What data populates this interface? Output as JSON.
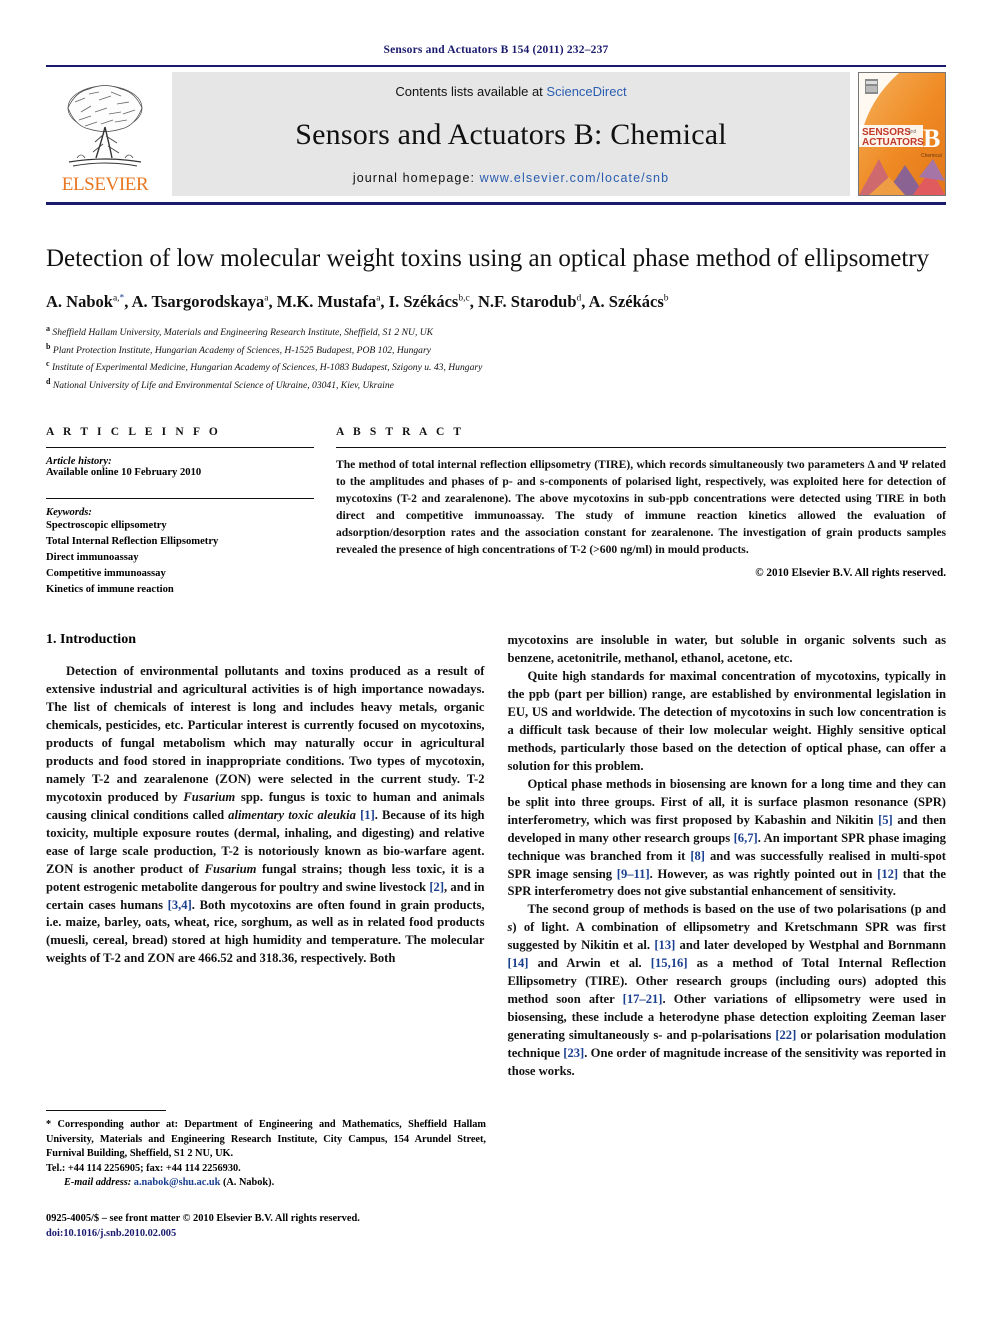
{
  "running_head": "Sensors and Actuators B 154 (2011) 232–237",
  "masthead": {
    "contents_prefix": "Contents lists available at ",
    "sciencedirect": "ScienceDirect",
    "journal_name": "Sensors and Actuators B: Chemical",
    "homepage_label": "journal homepage:",
    "homepage_url": "www.elsevier.com/locate/snb",
    "publisher": "ELSEVIER",
    "cover_line1": "SENSORS",
    "cover_line2": "ACTUATORS",
    "cover_and": "and",
    "cover_letter": "B",
    "cover_sub": "Chemical",
    "accent_blue": "#1a1a6e",
    "accent_orange": "#e87722",
    "link_blue": "#2a5db0"
  },
  "article": {
    "title": "Detection of low molecular weight toxins using an optical phase method of ellipsometry",
    "authors": [
      {
        "name": "A. Nabok",
        "sup": "a,",
        "star": "*"
      },
      {
        "name": "A. Tsargorodskaya",
        "sup": "a"
      },
      {
        "name": "M.K. Mustafa",
        "sup": "a"
      },
      {
        "name": "I. Székács",
        "sup": "b,c"
      },
      {
        "name": "N.F. Starodub",
        "sup": "d"
      },
      {
        "name": "A. Székács",
        "sup": "b"
      }
    ],
    "affiliations": [
      {
        "mark": "a",
        "text": "Sheffield Hallam University, Materials and Engineering Research Institute, Sheffield, S1 2 NU, UK"
      },
      {
        "mark": "b",
        "text": "Plant Protection Institute, Hungarian Academy of Sciences, H-1525 Budapest, POB 102, Hungary"
      },
      {
        "mark": "c",
        "text": "Institute of Experimental Medicine, Hungarian Academy of Sciences, H-1083 Budapest, Szigony u. 43, Hungary"
      },
      {
        "mark": "d",
        "text": "National University of Life and Environmental Science of Ukraine, 03041, Kiev, Ukraine"
      }
    ]
  },
  "article_info": {
    "heading": "A R T I C L E   I N F O",
    "history_label": "Article history:",
    "history_value": "Available online 10 February 2010",
    "keywords_label": "Keywords:",
    "keywords": [
      "Spectroscopic ellipsometry",
      "Total Internal Reflection Ellipsometry",
      "Direct immunoassay",
      "Competitive immunoassay",
      "Kinetics of immune reaction"
    ]
  },
  "abstract": {
    "heading": "A B S T R A C T",
    "text": "The method of total internal reflection ellipsometry (TIRE), which records simultaneously two parameters Δ and Ψ related to the amplitudes and phases of p- and s-components of polarised light, respectively, was exploited here for detection of mycotoxins (T-2 and zearalenone). The above mycotoxins in sub-ppb concentrations were detected using TIRE in both direct and competitive immunoassay. The study of immune reaction kinetics allowed the evaluation of adsorption/desorption rates and the association constant for zearalenone. The investigation of grain products samples revealed the presence of high concentrations of T-2 (>600 ng/ml) in mould products.",
    "copyright": "© 2010 Elsevier B.V. All rights reserved."
  },
  "body": {
    "section_number_title": "1.  Introduction",
    "left_paragraphs": [
      "Detection of environmental pollutants and toxins produced as a result of extensive industrial and agricultural activities is of high importance nowadays. The list of chemicals of interest is long and includes heavy metals, organic chemicals, pesticides, etc. Particular interest is currently focused on mycotoxins, products of fungal metabolism which may naturally occur in agricultural products and food stored in inappropriate conditions. Two types of mycotoxin, namely T-2 and zearalenone (ZON) were selected in the current study. T-2 mycotoxin produced by Fusarium spp. fungus is toxic to human and animals causing clinical conditions called alimentary toxic aleukia [1]. Because of its high toxicity, multiple exposure routes (dermal, inhaling, and digesting) and relative ease of large scale production, T-2 is notoriously known as bio-warfare agent. ZON is another product of Fusarium fungal strains; though less toxic, it is a potent estrogenic metabolite dangerous for poultry and swine livestock [2], and in certain cases humans [3,4]. Both mycotoxins are often found in grain products, i.e. maize, barley, oats, wheat, rice, sorghum, as well as in related food products (muesli, cereal, bread) stored at high humidity and temperature. The molecular weights of T-2 and ZON are 466.52 and 318.36, respectively. Both"
    ],
    "right_paragraphs": [
      "mycotoxins are insoluble in water, but soluble in organic solvents such as benzene, acetonitrile, methanol, ethanol, acetone, etc.",
      "Quite high standards for maximal concentration of mycotoxins, typically in the ppb (part per billion) range, are established by environmental legislation in EU, US and worldwide. The detection of mycotoxins in such low concentration is a difficult task because of their low molecular weight. Highly sensitive optical methods, particularly those based on the detection of optical phase, can offer a solution for this problem.",
      "Optical phase methods in biosensing are known for a long time and they can be split into three groups. First of all, it is surface plasmon resonance (SPR) interferometry, which was first proposed by Kabashin and Nikitin [5] and then developed in many other research groups [6,7]. An important SPR phase imaging technique was branched from it [8] and was successfully realised in multi-spot SPR image sensing [9–11]. However, as was rightly pointed out in [12] that the SPR interferometry does not give substantial enhancement of sensitivity.",
      "The second group of methods is based on the use of two polarisations (p and s) of light. A combination of ellipsometry and Kretschmann SPR was first suggested by Nikitin et al. [13] and later developed by Westphal and Bornmann [14] and Arwin et al. [15,16] as a method of Total Internal Reflection Ellipsometry (TIRE). Other research groups (including ours) adopted this method soon after [17–21]. Other variations of ellipsometry were used in biosensing, these include a heterodyne phase detection exploiting Zeeman laser generating simultaneously s- and p-polarisations [22] or polarisation modulation technique [23]. One order of magnitude increase of the sensitivity was reported in those works."
    ]
  },
  "footnote": {
    "corresponding": "* Corresponding author at: Department of Engineering and Mathematics, Sheffield Hallam University, Materials and Engineering Research Institute, City Campus, 154 Arundel Street, Furnival Building, Sheffield, S1 2 NU, UK.",
    "tel": "Tel.: +44 114 2256905; fax: +44 114 2256930.",
    "email_label": "E-mail address:",
    "email": "a.nabok@shu.ac.uk",
    "email_owner": "(A. Nabok).",
    "issn_line": "0925-4005/$ – see front matter © 2010 Elsevier B.V. All rights reserved.",
    "doi_line": "doi:10.1016/j.snb.2010.02.005"
  }
}
